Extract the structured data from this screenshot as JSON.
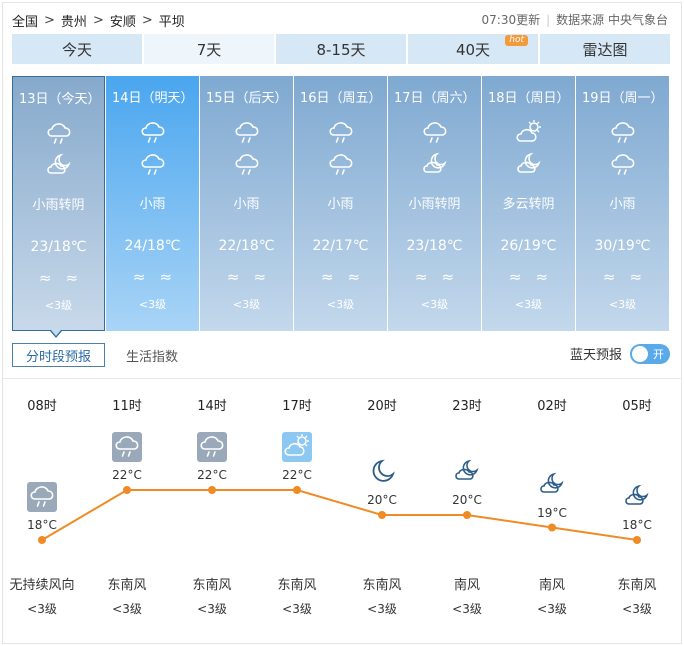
{
  "breadcrumb": [
    "全国",
    "贵州",
    "安顺",
    "平坝"
  ],
  "meta": {
    "updated": "07:30更新",
    "source": "数据来源 中央气象台"
  },
  "tabs": [
    {
      "label": "今天"
    },
    {
      "label": "7天",
      "active": true
    },
    {
      "label": "8-15天"
    },
    {
      "label": "40天",
      "badge": "hot"
    },
    {
      "label": "雷达图"
    }
  ],
  "days": [
    {
      "date": "13日（今天）",
      "icons": [
        "cloud-rain-icon",
        "partly-cloudy-night-icon"
      ],
      "condition": "小雨转阴",
      "temp": "23/18℃",
      "wind": "≈≈",
      "level": "<3级"
    },
    {
      "date": "14日（明天）",
      "icons": [
        "cloud-rain-icon",
        "cloud-rain-icon"
      ],
      "condition": "小雨",
      "temp": "24/18℃",
      "wind": "≈≈",
      "level": "<3级"
    },
    {
      "date": "15日（后天）",
      "icons": [
        "cloud-rain-icon",
        "cloud-rain-icon"
      ],
      "condition": "小雨",
      "temp": "22/18℃",
      "wind": "≈≈",
      "level": "<3级"
    },
    {
      "date": "16日（周五）",
      "icons": [
        "cloud-rain-icon",
        "cloud-rain-icon"
      ],
      "condition": "小雨",
      "temp": "22/17℃",
      "wind": "≈≈",
      "level": "<3级"
    },
    {
      "date": "17日（周六）",
      "icons": [
        "cloud-rain-icon",
        "partly-cloudy-night-icon"
      ],
      "condition": "小雨转阴",
      "temp": "23/18℃",
      "wind": "≈≈",
      "level": "<3级"
    },
    {
      "date": "18日（周日）",
      "icons": [
        "partly-sunny-icon",
        "partly-cloudy-night-icon"
      ],
      "condition": "多云转阴",
      "temp": "26/19℃",
      "wind": "≈≈",
      "level": "<3级"
    },
    {
      "date": "19日（周一）",
      "icons": [
        "cloud-rain-icon",
        "cloud-rain-icon"
      ],
      "condition": "小雨",
      "temp": "30/19℃",
      "wind": "≈≈",
      "level": "<3级"
    }
  ],
  "subtabs": {
    "hourly": "分时段预报",
    "life": "生活指数"
  },
  "blue_sky": {
    "label": "蓝天预报",
    "toggle": "开"
  },
  "hourly": [
    {
      "time": "08时",
      "icon": "cloud-rain-icon",
      "temp": "18°C",
      "temp_value": 18,
      "wind": "无持续风向",
      "level": "<3级"
    },
    {
      "time": "11时",
      "icon": "cloud-rain-icon",
      "temp": "22°C",
      "temp_value": 22,
      "wind": "东南风",
      "level": "<3级"
    },
    {
      "time": "14时",
      "icon": "cloud-rain-icon",
      "temp": "22°C",
      "temp_value": 22,
      "wind": "东南风",
      "level": "<3级"
    },
    {
      "time": "17时",
      "icon": "partly-sunny-icon",
      "temp": "22°C",
      "temp_value": 22,
      "wind": "东南风",
      "level": "<3级"
    },
    {
      "time": "20时",
      "icon": "moon-icon",
      "temp": "20°C",
      "temp_value": 20,
      "wind": "东南风",
      "level": "<3级"
    },
    {
      "time": "23时",
      "icon": "partly-cloudy-night-icon",
      "temp": "20°C",
      "temp_value": 20,
      "wind": "南风",
      "level": "<3级"
    },
    {
      "time": "02时",
      "icon": "partly-cloudy-night-icon",
      "temp": "19°C",
      "temp_value": 19,
      "wind": "南风",
      "level": "<3级"
    },
    {
      "time": "05时",
      "icon": "partly-cloudy-night-icon",
      "temp": "18°C",
      "temp_value": 18,
      "wind": "东南风",
      "level": "<3级"
    }
  ],
  "colors": {
    "line": "#f08a24",
    "tab_bg": "#d6e8f6",
    "accent": "#4aa6ef"
  }
}
